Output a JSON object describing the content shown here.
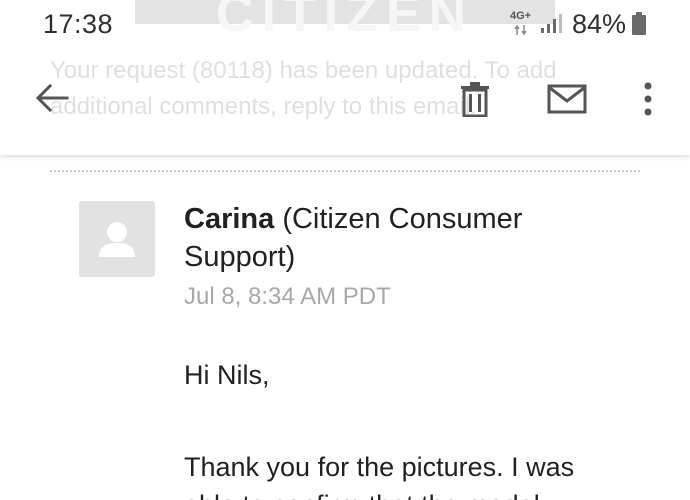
{
  "status_bar": {
    "time": "17:38",
    "network": "4G+",
    "battery_percent": "84%",
    "signal_icon": "signal-bars-icon",
    "battery_icon": "battery-icon"
  },
  "background_preview": {
    "logo_text": "CITIZEN",
    "text": "Your request (80118) has been updated. To add additional comments, reply to this email."
  },
  "toolbar": {
    "back_icon": "arrow-back-icon",
    "delete_icon": "trash-icon",
    "mail_icon": "envelope-icon",
    "more_icon": "more-vert-icon"
  },
  "message": {
    "sender_name": "Carina",
    "sender_org": " (Citizen Consumer Support)",
    "date": "Jul 8, 8:34 AM PDT",
    "greeting": "Hi Nils,",
    "body_line1": "Thank you for the pictures. I was",
    "body_line2": "able to confirm that the model"
  },
  "colors": {
    "text": "#202124",
    "muted": "#a8a8a8",
    "icon": "#555555",
    "avatar_bg": "#e2e2e2"
  }
}
